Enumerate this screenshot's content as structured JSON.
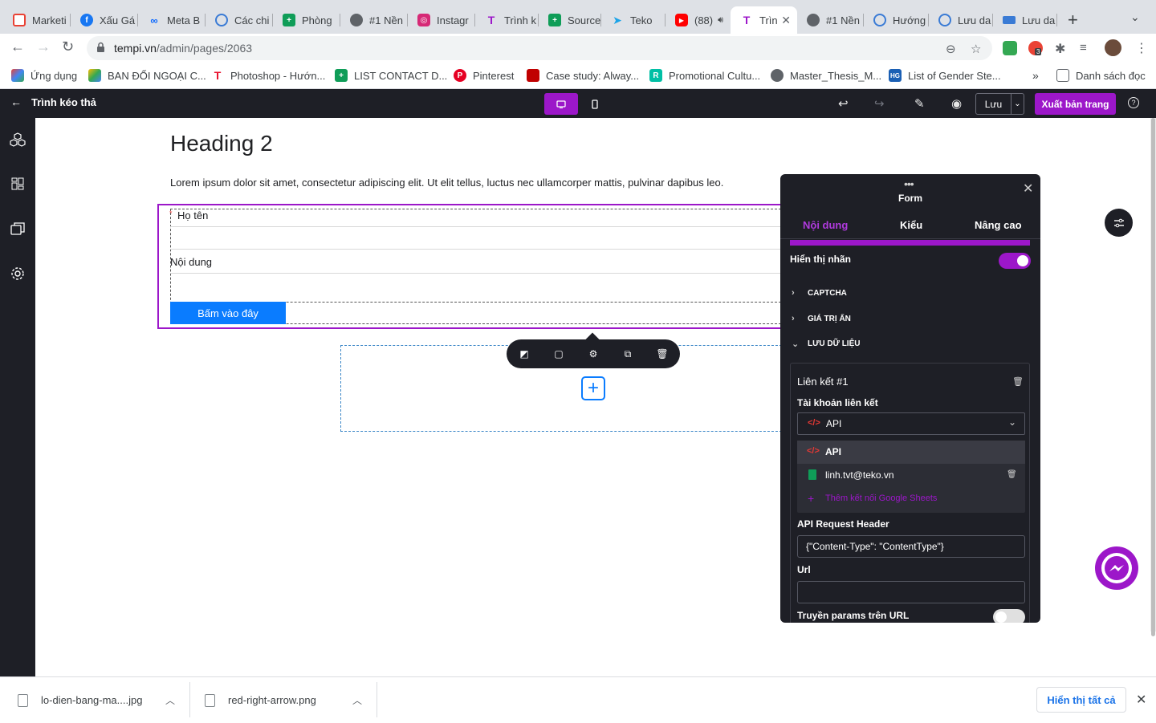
{
  "browser": {
    "tabs": [
      {
        "label": "Marketi",
        "icon": "chrome-icon",
        "color": "#e94235"
      },
      {
        "label": "Xấu Gá",
        "icon": "facebook-icon",
        "color": "#1877f2"
      },
      {
        "label": "Meta B",
        "icon": "meta-icon",
        "color": "#0866ff"
      },
      {
        "label": "Các chi",
        "icon": "tempi-icon",
        "color": "#3a7bd5"
      },
      {
        "label": "Phòng",
        "icon": "sheets-icon",
        "color": "#0f9d58"
      },
      {
        "label": "#1 Nền",
        "icon": "globe-icon",
        "color": "#5f6368"
      },
      {
        "label": "Instagr",
        "icon": "instagram-icon",
        "color": "#d62976"
      },
      {
        "label": "Trình k",
        "icon": "tempi-t-icon",
        "color": "#9c17c9"
      },
      {
        "label": "Source",
        "icon": "sheets-icon",
        "color": "#0f9d58"
      },
      {
        "label": "Teko",
        "icon": "teko-icon",
        "color": "#1aa3e8"
      },
      {
        "label": "(88)",
        "icon": "youtube-icon",
        "color": "#ff0000"
      },
      {
        "label": "Trìn",
        "icon": "tempi-t-icon",
        "color": "#9c17c9"
      },
      {
        "label": "#1 Nền",
        "icon": "globe-icon",
        "color": "#5f6368"
      },
      {
        "label": "Hướng",
        "icon": "tempi-icon",
        "color": "#3a7bd5"
      },
      {
        "label": "Lưu da",
        "icon": "tempi-icon",
        "color": "#3a7bd5"
      },
      {
        "label": "Lưu da",
        "icon": "layers-icon",
        "color": "#3a7bd5"
      }
    ],
    "url_host": "tempi.vn",
    "url_path": "/admin/pages/2063",
    "bookmarks": [
      {
        "label": "Ứng dụng",
        "icon": "apps-grid-icon",
        "color": "#ea4335"
      },
      {
        "label": "BAN ĐỐI NGOẠI C...",
        "icon": "drive-icon",
        "color": "#fbbc04"
      },
      {
        "label": "Photoshop - Hướn...",
        "icon": "tempi-t-icon",
        "color": "#e8112d"
      },
      {
        "label": "LIST CONTACT D...",
        "icon": "sheets-icon",
        "color": "#0f9d58"
      },
      {
        "label": "Pinterest",
        "icon": "pinterest-icon",
        "color": "#e60023"
      },
      {
        "label": "Case study: Alway...",
        "icon": "case-study-icon",
        "color": "#c00000"
      },
      {
        "label": "Promotional Cultu...",
        "icon": "r-icon",
        "color": "#00bfa5"
      },
      {
        "label": "Master_Thesis_M...",
        "icon": "globe-icon",
        "color": "#5f6368"
      },
      {
        "label": "List of Gender Ste...",
        "icon": "hg-icon",
        "color": "#1a5fb4"
      }
    ],
    "reading_list": "Danh sách đọc",
    "extension_badge": "3"
  },
  "app": {
    "back_label": "←",
    "title": "Trình kéo thả",
    "save_label": "Lưu",
    "publish_label": "Xuất bản trang",
    "accent": "#9c17c9"
  },
  "canvas": {
    "heading": "Heading 2",
    "paragraph": "Lorem ipsum dolor sit amet, consectetur adipiscing elit. Ut elit tellus, luctus nec ullamcorper mattis, pulvinar dapibus leo.",
    "form": {
      "required_mark": "*",
      "field1_label": "Họ tên",
      "field2_label": "Nội dung",
      "submit_label": "Bấm vào đây"
    }
  },
  "panel": {
    "title": "Form",
    "tabs": [
      "Nội dung",
      "Kiểu",
      "Nâng cao"
    ],
    "active_tab": "Nội dung",
    "show_label": "Hiển thị nhãn",
    "show_label_on": true,
    "sections": [
      "CAPTCHA",
      "GIÁ TRỊ ẨN",
      "LƯU DỮ LIỆU"
    ],
    "link": {
      "title": "Liên kết #1",
      "account_label": "Tài khoản liên kết",
      "selected": "API",
      "options": [
        "API",
        "linh.tvt@teko.vn"
      ],
      "add_label": "Thêm kết nối Google Sheets",
      "header_label": "API Request Header",
      "header_value": "{\"Content-Type\": \"ContentType\"}",
      "url_label": "Url",
      "url_value": "",
      "params_label": "Truyền params trên URL",
      "params_on": false
    }
  },
  "downloads": {
    "items": [
      "lo-dien-bang-ma....jpg",
      "red-right-arrow.png"
    ],
    "show_all": "Hiển thị tất cả"
  }
}
